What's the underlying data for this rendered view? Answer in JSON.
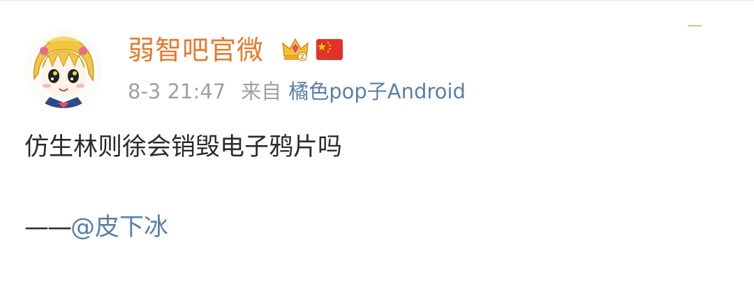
{
  "post": {
    "username": "弱智吧官微",
    "timestamp": "8-3 21:47",
    "source_prefix": "来自",
    "source": "橘色pop子Android",
    "content": "仿生林则徐会销毁电子鸦片吗",
    "signature_prefix": "——",
    "mention": "@皮下冰"
  },
  "icons": {
    "avatar": "cartoon-girl-avatar",
    "badge": "crown-icon",
    "flag": "china-flag-icon"
  },
  "colors": {
    "username": "#e8792a",
    "link": "#5b7fa6",
    "meta": "#a0a0a0",
    "text": "#2b2b2b"
  }
}
